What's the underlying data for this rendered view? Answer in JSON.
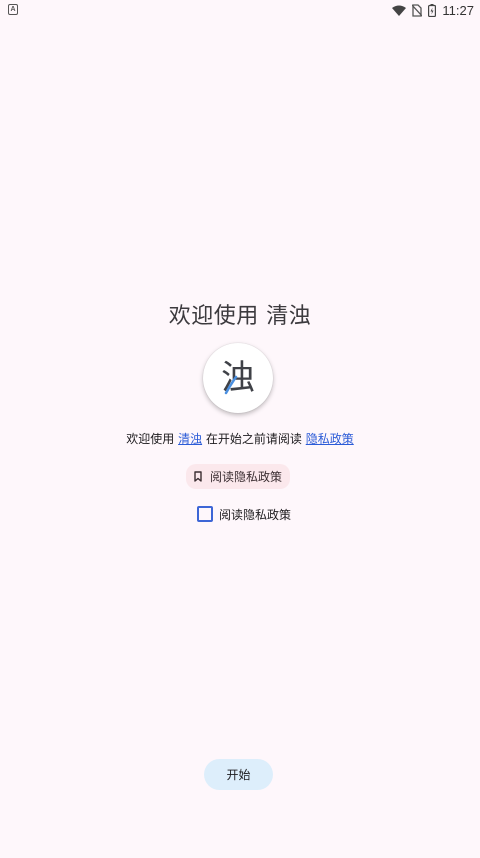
{
  "status_bar": {
    "notification_icon": "A",
    "icons": [
      "wifi-icon",
      "no-sim-icon",
      "battery-icon"
    ],
    "time": "11:27"
  },
  "welcome": {
    "title": "欢迎使用 清浊",
    "logo_char": "浊",
    "intro_prefix": "欢迎使用 ",
    "app_name_link": "清浊",
    "intro_middle": " 在开始之前请阅读 ",
    "privacy_link": "隐私政策 "
  },
  "read_policy_button": {
    "label": "阅读隐私政策",
    "icon": "bookmark-icon"
  },
  "policy_checkbox": {
    "label": "阅读隐私政策",
    "checked": false
  },
  "start_button": {
    "label": "开始"
  },
  "colors": {
    "background": "#fef7fb",
    "link": "#2b5bd7",
    "read_button_bg": "#fbe8ec",
    "start_button_bg": "#ddeefb",
    "checkbox_border": "#3d66d6"
  }
}
